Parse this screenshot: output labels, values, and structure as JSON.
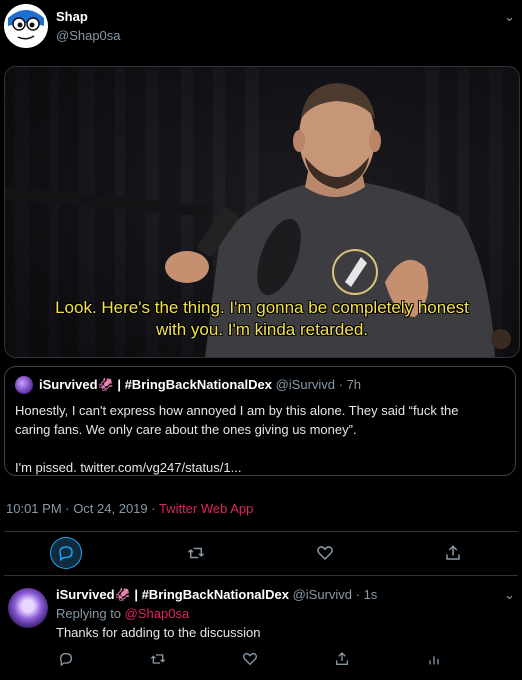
{
  "tweet": {
    "author_name": "Shap",
    "author_handle": "@Shap0sa",
    "media": {
      "caption_line1": "Look. Here's the thing. I'm gonna be completely honest",
      "caption_line2": "with you. I'm kinda retarded."
    },
    "quote": {
      "author_name": "iSurvived🦑 | #BringBackNationalDex",
      "author_handle_time": "@iSurvivd · 7h",
      "text_line1": "Honestly, I can't express how annoyed I am by this alone. They said “fuck the",
      "text_line2": "caring fans. We only care about the ones giving us money”.",
      "text_line3": "I'm pissed. twitter.com/vg247/status/1..."
    },
    "timestamp": "10:01 PM · Oct 24, 2019 · ",
    "source_app": "Twitter Web App"
  },
  "actions": {
    "reply": "reply-icon",
    "retweet": "retweet-icon",
    "like": "heart-icon",
    "share": "share-icon"
  },
  "reply": {
    "author_name": "iSurvived🦑 | #BringBackNationalDex",
    "author_handle_time": "@iSurvivd · 1s",
    "replying_prefix": "Replying to ",
    "replying_mention": "@Shap0sa",
    "text": "Thanks for adding to the discussion"
  },
  "colors": {
    "accent": "#1da1f2",
    "source_app": "#e0245e",
    "background": "#000000"
  }
}
